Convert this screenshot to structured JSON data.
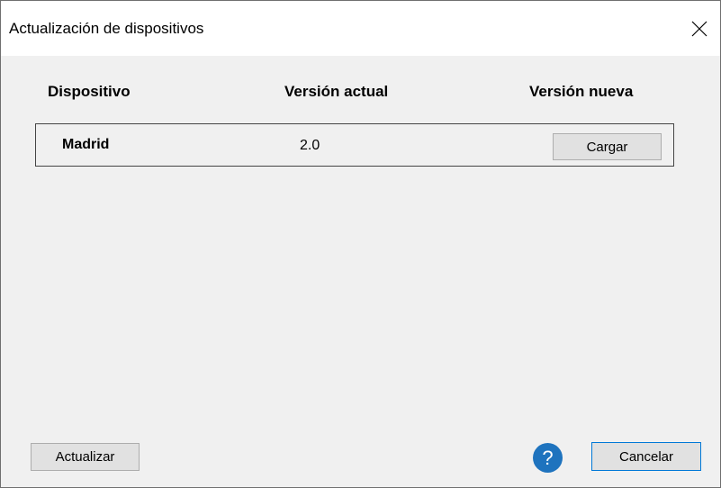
{
  "window": {
    "title": "Actualización de dispositivos"
  },
  "table": {
    "headers": {
      "device": "Dispositivo",
      "current_version": "Versión actual",
      "new_version": "Versión nueva"
    },
    "rows": [
      {
        "device": "Madrid",
        "current_version": "2.0",
        "action_label": "Cargar"
      }
    ]
  },
  "footer": {
    "update_label": "Actualizar",
    "help_glyph": "?",
    "cancel_label": "Cancelar"
  },
  "icons": {
    "close": "close-icon",
    "help": "help-icon"
  },
  "colors": {
    "dialog_background": "#f0f0f0",
    "help_icon": "#1e73be",
    "focused_button_border": "#0078d7"
  }
}
